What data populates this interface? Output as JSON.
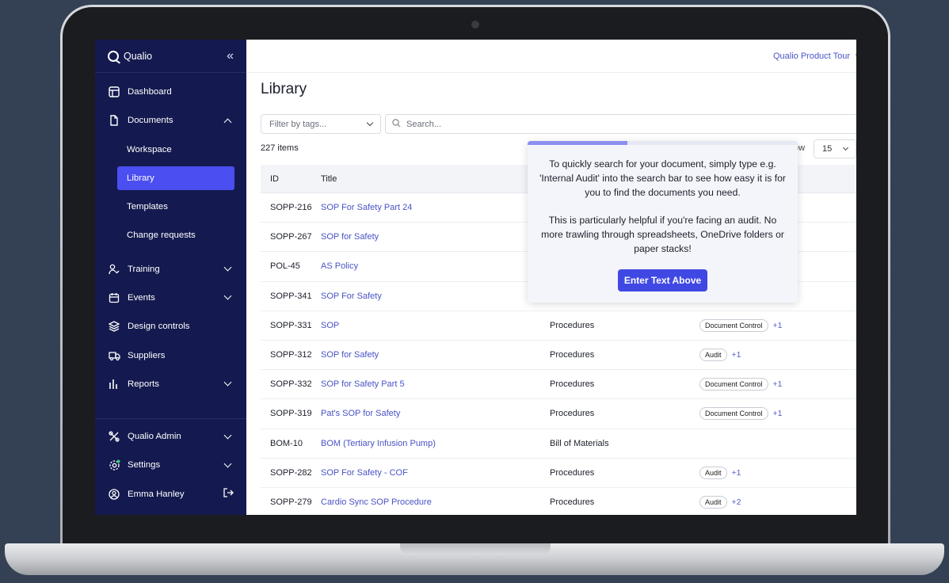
{
  "app": {
    "brand": "Qualio",
    "collapse_icon": "«"
  },
  "topbar": {
    "tour_label": "Qualio Product Tour"
  },
  "sidebar": {
    "items": [
      {
        "label": "Dashboard",
        "icon": "dashboard-icon"
      },
      {
        "label": "Documents",
        "icon": "document-icon",
        "expanded": true
      },
      {
        "label": "Workspace"
      },
      {
        "label": "Library",
        "active": true
      },
      {
        "label": "Templates"
      },
      {
        "label": "Change requests"
      },
      {
        "label": "Training",
        "icon": "training-icon"
      },
      {
        "label": "Events",
        "icon": "calendar-icon"
      },
      {
        "label": "Design controls",
        "icon": "layers-icon"
      },
      {
        "label": "Suppliers",
        "icon": "truck-icon"
      },
      {
        "label": "Reports",
        "icon": "bar-chart-icon"
      }
    ],
    "bottom": [
      {
        "label": "Qualio Admin",
        "icon": "tools-icon"
      },
      {
        "label": "Settings",
        "icon": "gear-icon"
      },
      {
        "label": "Emma Hanley",
        "icon": "user-icon"
      }
    ]
  },
  "page": {
    "title": "Library",
    "filter_placeholder": "Filter by tags...",
    "search_placeholder": "Search...",
    "count": "227 items",
    "show_label": "ow",
    "per_page": "15"
  },
  "table": {
    "headers": {
      "id": "ID",
      "title": "Title"
    },
    "rows": [
      {
        "id": "SOPP-216",
        "title": "SOP For Safety Part 24",
        "type": "",
        "tag": "",
        "more": ""
      },
      {
        "id": "SOPP-267",
        "title": "SOP for Safety",
        "type": "",
        "tag": "",
        "more": ""
      },
      {
        "id": "POL-45",
        "title": "AS Policy",
        "type": "",
        "tag": "",
        "more": ""
      },
      {
        "id": "SOPP-341",
        "title": "SOP For Safety",
        "type": "",
        "tag": "",
        "more": ""
      },
      {
        "id": "SOPP-331",
        "title": "SOP",
        "type": "Procedures",
        "tag": "Document Control",
        "more": "+1"
      },
      {
        "id": "SOPP-312",
        "title": "SOP for Safety",
        "type": "Procedures",
        "tag": "Audit",
        "more": "+1"
      },
      {
        "id": "SOPP-332",
        "title": "SOP for Safety Part 5",
        "type": "Procedures",
        "tag": "Document Control",
        "more": "+1"
      },
      {
        "id": "SOPP-319",
        "title": "Pat's SOP for Safety",
        "type": "Procedures",
        "tag": "Document Control",
        "more": "+1"
      },
      {
        "id": "BOM-10",
        "title": "BOM (Tertiary Infusion Pump)",
        "type": "Bill of Materials",
        "tag": "",
        "more": ""
      },
      {
        "id": "SOPP-282",
        "title": "SOP For Safety - COF",
        "type": "Procedures",
        "tag": "Audit",
        "more": "+1"
      },
      {
        "id": "SOPP-279",
        "title": "Cardio Sync SOP Procedure",
        "type": "Procedures",
        "tag": "Audit",
        "more": "+2"
      }
    ]
  },
  "popover": {
    "progress": 0.37,
    "text1": "To quickly search for your document, simply type e.g. 'Internal Audit' into the search bar to see how easy it is for you to find the documents you need.",
    "text2": "This is particularly helpful if you're facing an audit. No more trawling through spreadsheets, OneDrive folders or paper stacks!",
    "button": "Enter Text Above"
  },
  "colors": {
    "sidebar": "#141a4f",
    "accent": "#4b4ef0",
    "link": "#4953c5"
  }
}
